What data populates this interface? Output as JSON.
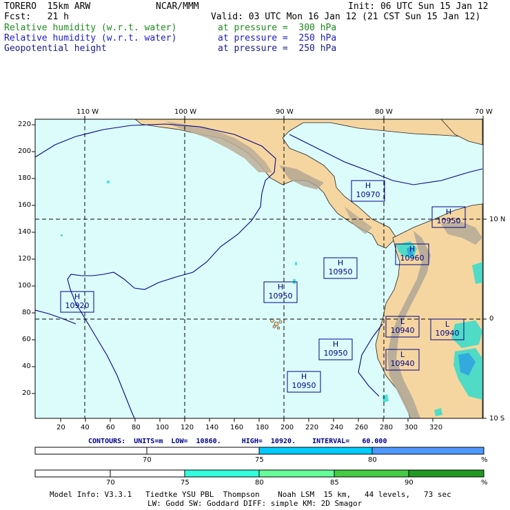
{
  "header": {
    "model": "TORERO  15km ARW",
    "center": "NCAR/MMM",
    "init": "Init: 06 UTC Sun 15 Jan 12",
    "fcst": "Fcst:   21 h",
    "valid": "Valid: 03 UTC Mon 16 Jan 12 (21 CST Sun 15 Jan 12)",
    "fields": [
      {
        "name": "Relative humidity (w.r.t. water)",
        "level": "at pressure =  300 hPa",
        "color": "#1a8a1a"
      },
      {
        "name": "Relative humidity (w.r.t. water)",
        "level": "at pressure =  250 hPa",
        "color": "#1a1acc"
      },
      {
        "name": "Geopotential height",
        "level": "at pressure =  250 hPa",
        "color": "#1a1a8a"
      }
    ]
  },
  "map": {
    "top_lon_labels": [
      "110 W",
      "100 W",
      "90 W",
      "80 W",
      "70 W"
    ],
    "right_lat_labels": [
      "10 N",
      "0",
      "10 S"
    ],
    "y_ticks": [
      "220",
      "200",
      "180",
      "160",
      "140",
      "120",
      "100",
      "80",
      "60",
      "40",
      "20"
    ],
    "x_ticks": [
      "20",
      "40",
      "60",
      "80",
      "100",
      "120",
      "140",
      "160",
      "180",
      "200",
      "220",
      "240",
      "260",
      "280",
      "300",
      "320"
    ],
    "highs_lows": [
      {
        "type": "H",
        "value": "10970"
      },
      {
        "type": "H",
        "value": "10950"
      },
      {
        "type": "H",
        "value": "10960"
      },
      {
        "type": "H",
        "value": "10950"
      },
      {
        "type": "H",
        "value": "10950"
      },
      {
        "type": "H",
        "value": "10920"
      },
      {
        "type": "L",
        "value": "10940"
      },
      {
        "type": "L",
        "value": "10940"
      },
      {
        "type": "H",
        "value": "10950"
      },
      {
        "type": "L",
        "value": "10940"
      },
      {
        "type": "H",
        "value": "10950"
      }
    ],
    "colors": {
      "ocean": "#dcfcfc",
      "land": "#f5d6a0",
      "terrain": "#c8b89a",
      "contour": "#00008b",
      "coast": "#000050"
    }
  },
  "contours_line": "CONTOURS:  UNITS=m  LOW=  10860.     HIGH=  10920.    INTERVAL=   60.000",
  "colorbar1": {
    "labels": [
      "70",
      "75",
      "80"
    ],
    "unit": "%",
    "colors": [
      "#ffffff",
      "#00ccff",
      "#3399ff"
    ]
  },
  "colorbar2": {
    "labels": [
      "70",
      "75",
      "80",
      "85",
      "90"
    ],
    "unit": "%",
    "colors": [
      "#ffffff",
      "#ffffff",
      "#33ffcc",
      "#66ff99",
      "#44cc44",
      "#229922"
    ]
  },
  "footer": {
    "line1": "Model Info: V3.3.1   Tiedtke YSU PBL  Thompson    Noah LSM  15 km,   44 levels,   73 sec",
    "line2": "LW: Godd SW: Goddard DIFF: simple KM: 2D Smagor"
  }
}
